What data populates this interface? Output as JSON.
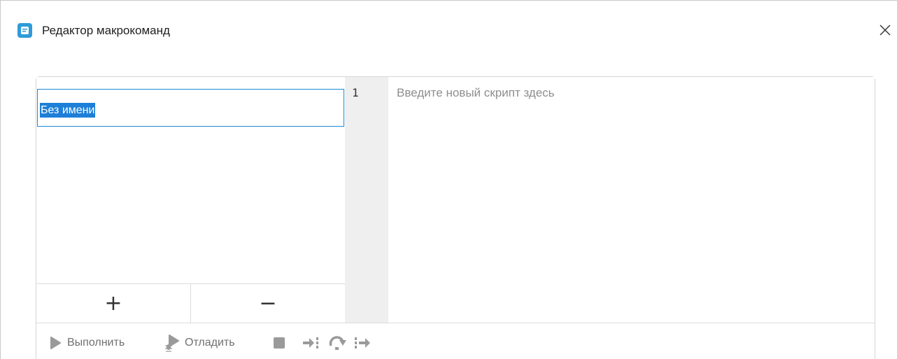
{
  "window": {
    "title": "Редактор макрокоманд",
    "icon": "app-logo-icon",
    "close_icon": "close-icon"
  },
  "macros": {
    "items": [
      {
        "name": "Без имени",
        "selected": true
      }
    ],
    "add_label": "+",
    "remove_label": "−"
  },
  "editor": {
    "line_numbers": [
      "1"
    ],
    "placeholder": "Введите новый скрипт здесь",
    "content": ""
  },
  "toolbar": {
    "run_label": "Выполнить",
    "debug_label": "Отладить",
    "icons": [
      "play-icon",
      "debug-icon",
      "stop-icon",
      "step-into-icon",
      "step-over-icon",
      "step-out-icon"
    ]
  },
  "colors": {
    "accent": "#1e7fd8",
    "selection": "#1e7fd8",
    "app_icon": "#2f9bd8",
    "disabled_icon": "#9a9a9a",
    "gutter": "#efefef"
  }
}
